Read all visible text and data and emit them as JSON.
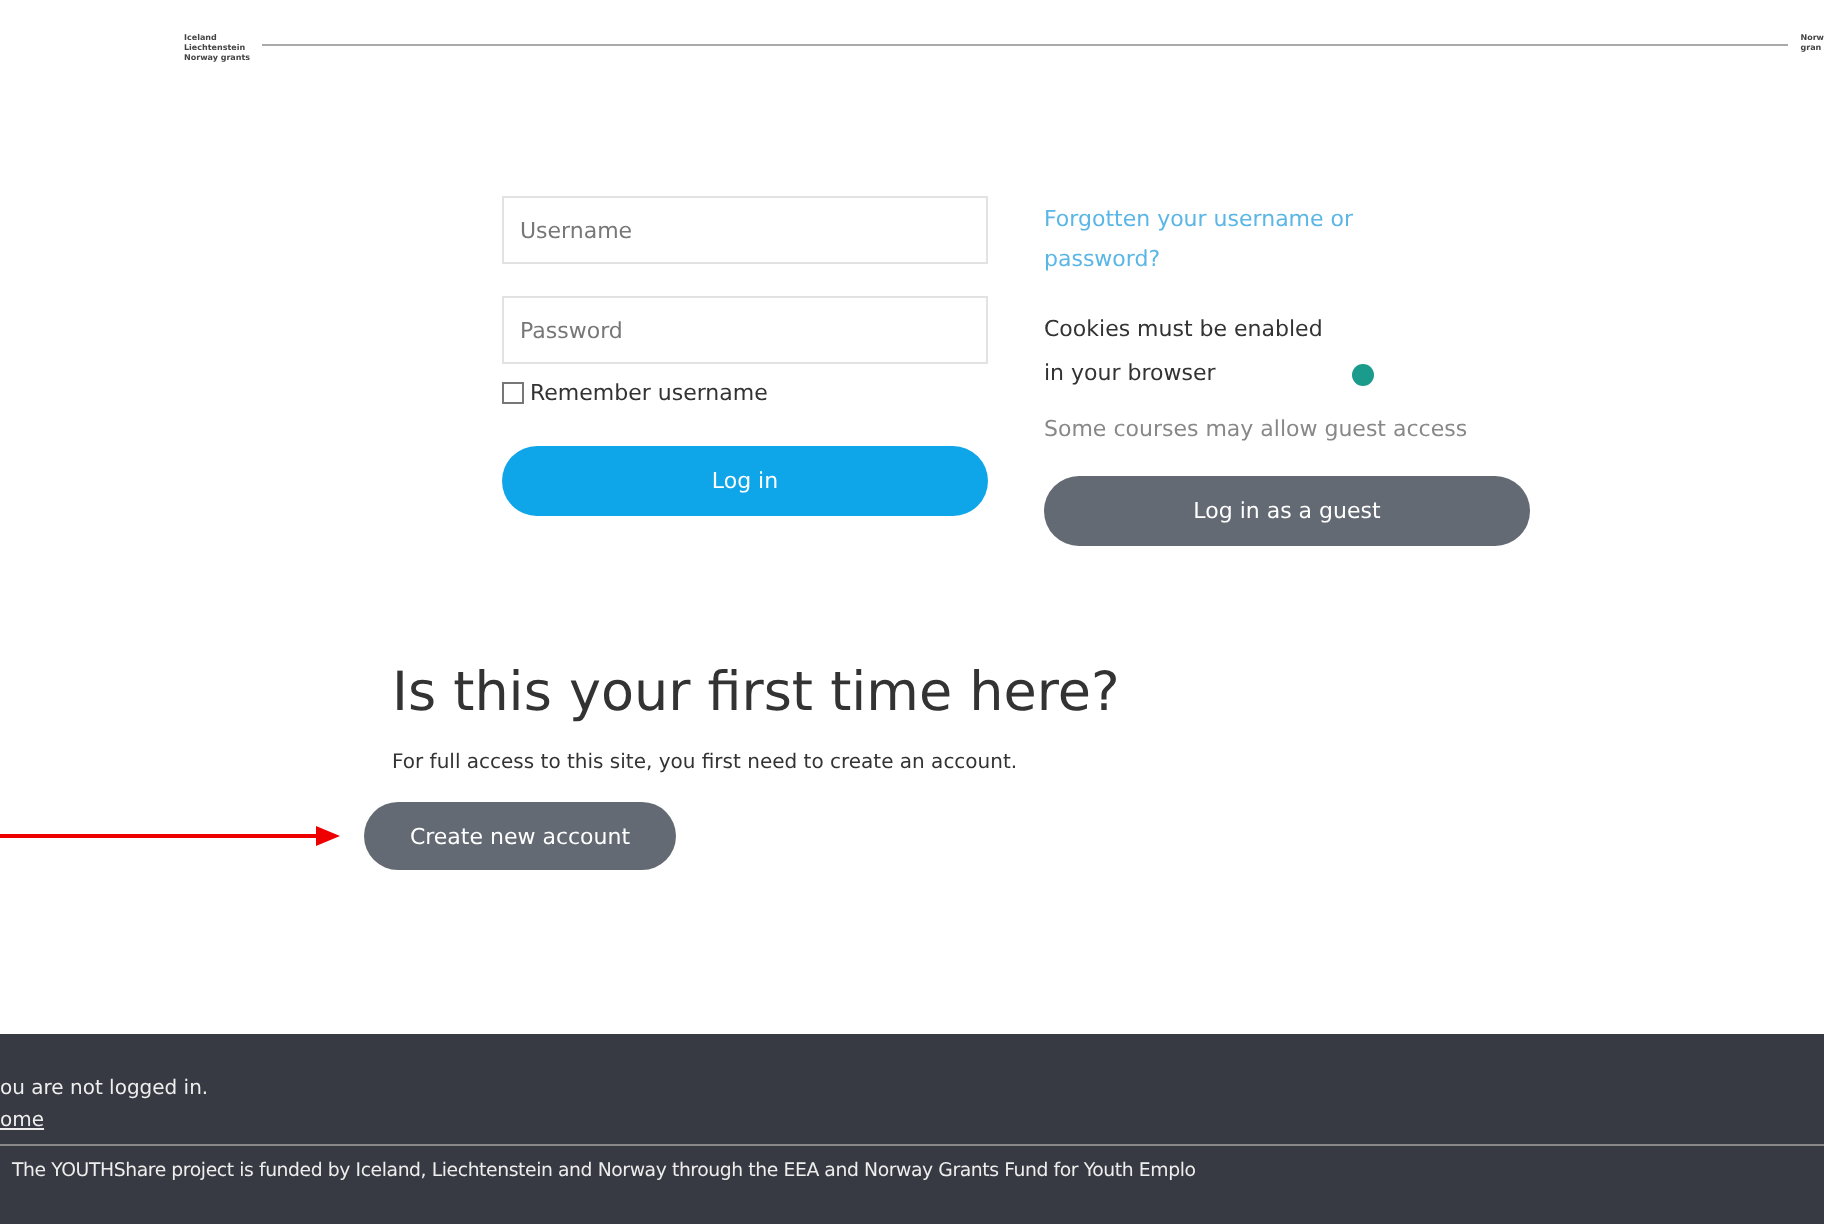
{
  "header": {
    "left_logo": [
      "Iceland",
      "Liechtenstein",
      "Norway grants"
    ],
    "right_logo": [
      "Norw",
      "gran"
    ]
  },
  "login": {
    "username": {
      "placeholder": "Username"
    },
    "password": {
      "placeholder": "Password"
    },
    "remember": {
      "label": "Remember username",
      "checked": false
    },
    "login_button": "Log in"
  },
  "aside": {
    "forgot_link": "Forgotten your username or password?",
    "cookies_note": "Cookies must be enabled in your browser",
    "guest_note": "Some courses may allow guest access",
    "guest_button": "Log in as a guest"
  },
  "signup": {
    "title": "Is this your first time here?",
    "text": "For full access to this site, you first need to create an account.",
    "button": "Create new account"
  },
  "footer": {
    "login_info": "ou are not logged in.",
    "home_link": "ome",
    "funding": "The YOUTHShare project is funded by Iceland, Liechtenstein and Norway through the EEA and Norway Grants Fund for Youth Emplo"
  }
}
